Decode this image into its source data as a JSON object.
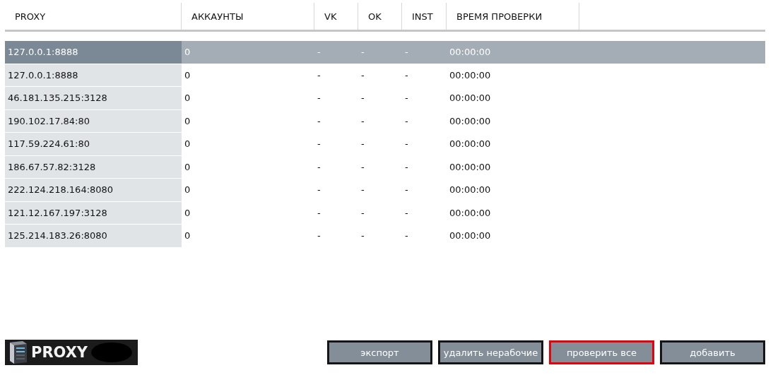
{
  "table": {
    "columns": [
      "PROXY",
      "АККАУНТЫ",
      "VK",
      "OK",
      "INST",
      "ВРЕМЯ ПРОВЕРКИ"
    ],
    "rows": [
      {
        "proxy": "127.0.0.1:8888",
        "accounts": "0",
        "vk": "-",
        "ok": "-",
        "inst": "-",
        "time": "00:00:00",
        "selected": true
      },
      {
        "proxy": "127.0.0.1:8888",
        "accounts": "0",
        "vk": "-",
        "ok": "-",
        "inst": "-",
        "time": "00:00:00",
        "selected": false
      },
      {
        "proxy": "46.181.135.215:3128",
        "accounts": "0",
        "vk": "-",
        "ok": "-",
        "inst": "-",
        "time": "00:00:00",
        "selected": false
      },
      {
        "proxy": "190.102.17.84:80",
        "accounts": "0",
        "vk": "-",
        "ok": "-",
        "inst": "-",
        "time": "00:00:00",
        "selected": false
      },
      {
        "proxy": "117.59.224.61:80",
        "accounts": "0",
        "vk": "-",
        "ok": "-",
        "inst": "-",
        "time": "00:00:00",
        "selected": false
      },
      {
        "proxy": "186.67.57.82:3128",
        "accounts": "0",
        "vk": "-",
        "ok": "-",
        "inst": "-",
        "time": "00:00:00",
        "selected": false
      },
      {
        "proxy": "222.124.218.164:8080",
        "accounts": "0",
        "vk": "-",
        "ok": "-",
        "inst": "-",
        "time": "00:00:00",
        "selected": false
      },
      {
        "proxy": "121.12.167.197:3128",
        "accounts": "0",
        "vk": "-",
        "ok": "-",
        "inst": "-",
        "time": "00:00:00",
        "selected": false
      },
      {
        "proxy": "125.214.183.26:8080",
        "accounts": "0",
        "vk": "-",
        "ok": "-",
        "inst": "-",
        "time": "00:00:00",
        "selected": false
      }
    ]
  },
  "logo": {
    "text": "PROXY"
  },
  "buttons": [
    {
      "label": "экспорт",
      "focused": false
    },
    {
      "label": "удалить нерабочие",
      "focused": false
    },
    {
      "label": "проверить все",
      "focused": true
    },
    {
      "label": "добавить",
      "focused": false
    }
  ]
}
